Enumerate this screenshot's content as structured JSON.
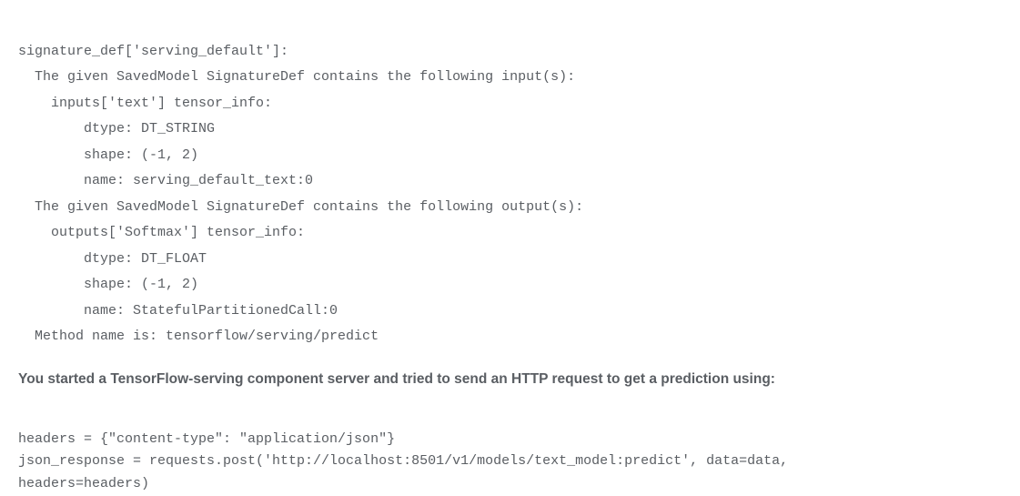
{
  "signature_block": {
    "l1": "signature_def['serving_default']:",
    "l2": "  The given SavedModel SignatureDef contains the following input(s):",
    "l3": "    inputs['text'] tensor_info:",
    "l4": "        dtype: DT_STRING",
    "l5": "        shape: (-1, 2)",
    "l6": "        name: serving_default_text:0",
    "l7": "  The given SavedModel SignatureDef contains the following output(s):",
    "l8": "    outputs['Softmax'] tensor_info:",
    "l9": "        dtype: DT_FLOAT",
    "l10": "        shape: (-1, 2)",
    "l11": "        name: StatefulPartitionedCall:0",
    "l12": "  Method name is: tensorflow/serving/predict"
  },
  "prose_text": "You started a TensorFlow-serving component server and tried to send an HTTP request to get a prediction using:",
  "request_block": {
    "l1": "headers = {\"content-type\": \"application/json\"}",
    "l2": "json_response = requests.post('http://localhost:8501/v1/models/text_model:predict', data=data,",
    "l3": "headers=headers)"
  }
}
